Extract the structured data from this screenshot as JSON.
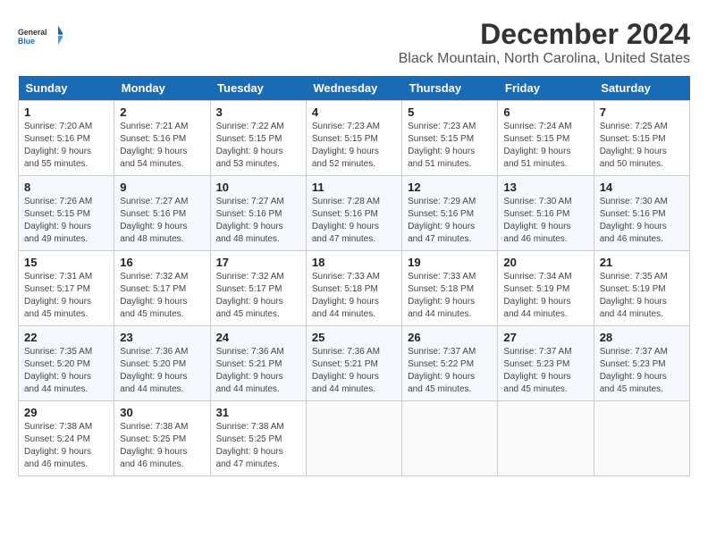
{
  "logo": {
    "text_general": "General",
    "text_blue": "Blue"
  },
  "header": {
    "month": "December 2024",
    "location": "Black Mountain, North Carolina, United States"
  },
  "weekdays": [
    "Sunday",
    "Monday",
    "Tuesday",
    "Wednesday",
    "Thursday",
    "Friday",
    "Saturday"
  ],
  "weeks": [
    [
      {
        "day": "1",
        "info": "Sunrise: 7:20 AM\nSunset: 5:16 PM\nDaylight: 9 hours\nand 55 minutes."
      },
      {
        "day": "2",
        "info": "Sunrise: 7:21 AM\nSunset: 5:16 PM\nDaylight: 9 hours\nand 54 minutes."
      },
      {
        "day": "3",
        "info": "Sunrise: 7:22 AM\nSunset: 5:15 PM\nDaylight: 9 hours\nand 53 minutes."
      },
      {
        "day": "4",
        "info": "Sunrise: 7:23 AM\nSunset: 5:15 PM\nDaylight: 9 hours\nand 52 minutes."
      },
      {
        "day": "5",
        "info": "Sunrise: 7:23 AM\nSunset: 5:15 PM\nDaylight: 9 hours\nand 51 minutes."
      },
      {
        "day": "6",
        "info": "Sunrise: 7:24 AM\nSunset: 5:15 PM\nDaylight: 9 hours\nand 51 minutes."
      },
      {
        "day": "7",
        "info": "Sunrise: 7:25 AM\nSunset: 5:15 PM\nDaylight: 9 hours\nand 50 minutes."
      }
    ],
    [
      {
        "day": "8",
        "info": "Sunrise: 7:26 AM\nSunset: 5:15 PM\nDaylight: 9 hours\nand 49 minutes."
      },
      {
        "day": "9",
        "info": "Sunrise: 7:27 AM\nSunset: 5:16 PM\nDaylight: 9 hours\nand 48 minutes."
      },
      {
        "day": "10",
        "info": "Sunrise: 7:27 AM\nSunset: 5:16 PM\nDaylight: 9 hours\nand 48 minutes."
      },
      {
        "day": "11",
        "info": "Sunrise: 7:28 AM\nSunset: 5:16 PM\nDaylight: 9 hours\nand 47 minutes."
      },
      {
        "day": "12",
        "info": "Sunrise: 7:29 AM\nSunset: 5:16 PM\nDaylight: 9 hours\nand 47 minutes."
      },
      {
        "day": "13",
        "info": "Sunrise: 7:30 AM\nSunset: 5:16 PM\nDaylight: 9 hours\nand 46 minutes."
      },
      {
        "day": "14",
        "info": "Sunrise: 7:30 AM\nSunset: 5:16 PM\nDaylight: 9 hours\nand 46 minutes."
      }
    ],
    [
      {
        "day": "15",
        "info": "Sunrise: 7:31 AM\nSunset: 5:17 PM\nDaylight: 9 hours\nand 45 minutes."
      },
      {
        "day": "16",
        "info": "Sunrise: 7:32 AM\nSunset: 5:17 PM\nDaylight: 9 hours\nand 45 minutes."
      },
      {
        "day": "17",
        "info": "Sunrise: 7:32 AM\nSunset: 5:17 PM\nDaylight: 9 hours\nand 45 minutes."
      },
      {
        "day": "18",
        "info": "Sunrise: 7:33 AM\nSunset: 5:18 PM\nDaylight: 9 hours\nand 44 minutes."
      },
      {
        "day": "19",
        "info": "Sunrise: 7:33 AM\nSunset: 5:18 PM\nDaylight: 9 hours\nand 44 minutes."
      },
      {
        "day": "20",
        "info": "Sunrise: 7:34 AM\nSunset: 5:19 PM\nDaylight: 9 hours\nand 44 minutes."
      },
      {
        "day": "21",
        "info": "Sunrise: 7:35 AM\nSunset: 5:19 PM\nDaylight: 9 hours\nand 44 minutes."
      }
    ],
    [
      {
        "day": "22",
        "info": "Sunrise: 7:35 AM\nSunset: 5:20 PM\nDaylight: 9 hours\nand 44 minutes."
      },
      {
        "day": "23",
        "info": "Sunrise: 7:36 AM\nSunset: 5:20 PM\nDaylight: 9 hours\nand 44 minutes."
      },
      {
        "day": "24",
        "info": "Sunrise: 7:36 AM\nSunset: 5:21 PM\nDaylight: 9 hours\nand 44 minutes."
      },
      {
        "day": "25",
        "info": "Sunrise: 7:36 AM\nSunset: 5:21 PM\nDaylight: 9 hours\nand 44 minutes."
      },
      {
        "day": "26",
        "info": "Sunrise: 7:37 AM\nSunset: 5:22 PM\nDaylight: 9 hours\nand 45 minutes."
      },
      {
        "day": "27",
        "info": "Sunrise: 7:37 AM\nSunset: 5:23 PM\nDaylight: 9 hours\nand 45 minutes."
      },
      {
        "day": "28",
        "info": "Sunrise: 7:37 AM\nSunset: 5:23 PM\nDaylight: 9 hours\nand 45 minutes."
      }
    ],
    [
      {
        "day": "29",
        "info": "Sunrise: 7:38 AM\nSunset: 5:24 PM\nDaylight: 9 hours\nand 46 minutes."
      },
      {
        "day": "30",
        "info": "Sunrise: 7:38 AM\nSunset: 5:25 PM\nDaylight: 9 hours\nand 46 minutes."
      },
      {
        "day": "31",
        "info": "Sunrise: 7:38 AM\nSunset: 5:25 PM\nDaylight: 9 hours\nand 47 minutes."
      },
      {
        "day": "",
        "info": ""
      },
      {
        "day": "",
        "info": ""
      },
      {
        "day": "",
        "info": ""
      },
      {
        "day": "",
        "info": ""
      }
    ]
  ]
}
